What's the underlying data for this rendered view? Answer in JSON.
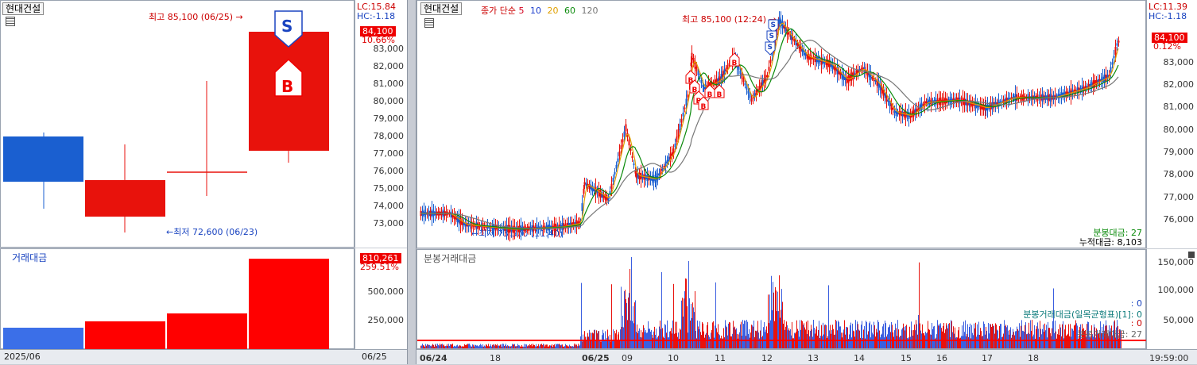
{
  "left": {
    "title": "현대건설",
    "lc": "LC:15.84",
    "hc": "HC:-1.18",
    "price_tag": "84,100",
    "pct": "10.66%",
    "high_note": "최고 85,100 (06/25)",
    "low_note": "최저 72,600 (06/23)",
    "y_ticks": [
      "83,000",
      "82,000",
      "81,000",
      "80,000",
      "79,000",
      "78,000",
      "77,000",
      "76,000",
      "75,000",
      "74,000",
      "73,000"
    ],
    "vol_title": "거래대금",
    "vol_tag": "810,261",
    "vol_pct": "259.51%",
    "vol_ticks": [
      "500,000",
      "250,000"
    ],
    "date_left": "2025/06",
    "date_right": "06/25",
    "sell_marker": "S",
    "buy_marker": "B"
  },
  "right": {
    "title": "현대건설",
    "ma_label": "종가 단순",
    "ma": [
      "5",
      "10",
      "20",
      "60",
      "120"
    ],
    "ma_colors": [
      "#d4001f",
      "#1a3ccc",
      "#e0a000",
      "#0a8a0a",
      "#777777"
    ],
    "lc": "LC:11.39",
    "hc": "HC:-1.18",
    "price_tag": "84,100",
    "pct": "0.12%",
    "high_note": "최고 85,100 (12:24)",
    "low_note": "최저 73,500 (11:40)",
    "y_ticks": [
      "83,000",
      "82,000",
      "81,000",
      "80,000",
      "79,000",
      "78,000",
      "77,000",
      "76,000"
    ],
    "minute_amt": "분봉대금: 27",
    "cum_amt": "누적대금: 8,103",
    "vol_title": "분봉거래대금",
    "vol_ticks": [
      "150,000",
      "100,000",
      "50,000"
    ],
    "vol_legend1": "분봉거래대금(일목균형표)[1]: 0",
    "vol_legend2": ": 0",
    "vol_legend3": ": 0",
    "vol_legend4": "분봉거래대금: 27",
    "x_ticks": [
      "06/24",
      "18",
      "06/25",
      "09",
      "10",
      "11",
      "12",
      "13",
      "14",
      "15",
      "16",
      "17",
      "18"
    ],
    "time": "19:59:00",
    "buy_marker": "B",
    "sell_marker": "S"
  },
  "colors": {
    "up": "#e8120c",
    "down": "#1a5fd0",
    "accent_red": "#e00000",
    "accent_blue": "#1a44c0"
  }
}
